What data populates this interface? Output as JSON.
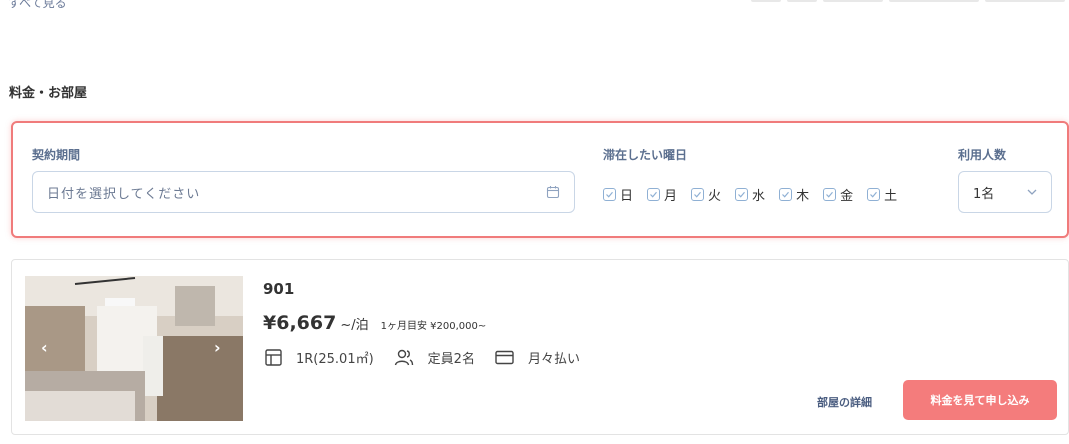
{
  "top": {
    "back_link": "すべて見る"
  },
  "section": {
    "title": "料金・お部屋"
  },
  "filter": {
    "period_label": "契約期間",
    "date_placeholder": "日付を選択してください",
    "weekday_label": "滞在したい曜日",
    "weekdays": [
      "日",
      "月",
      "火",
      "水",
      "木",
      "金",
      "土"
    ],
    "guests_label": "利用人数",
    "guests_value": "1名",
    "accent_color": "#f07b7b"
  },
  "room": {
    "name": "901",
    "price": "¥6,667",
    "price_unit": "~/泊",
    "monthly_estimate": "1ヶ月目安 ¥200,000~",
    "layout": "1R(25.01㎡)",
    "capacity": "定員2名",
    "payment": "月々払い",
    "detail_link": "部屋の詳細",
    "apply_button": "料金を見て申し込み",
    "apply_color": "#f47c7c"
  }
}
